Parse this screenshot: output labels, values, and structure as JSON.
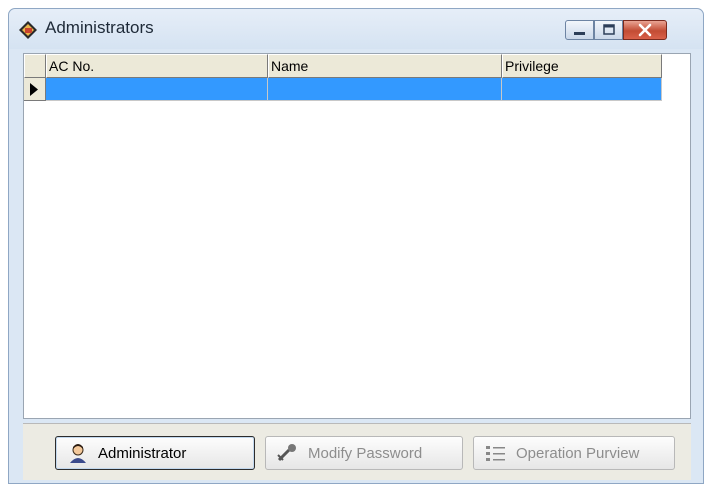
{
  "window": {
    "title": "Administrators"
  },
  "grid": {
    "columns": [
      "AC No.",
      "Name",
      "Privilege"
    ],
    "rows": [
      [
        "",
        "",
        ""
      ]
    ],
    "selected_row_color": "#3399ff"
  },
  "buttons": {
    "administrator": "Administrator",
    "modify_password": "Modify Password",
    "operation_purview": "Operation Purview"
  },
  "colors": {
    "title_bg": "#dbe7f4",
    "close_button": "#c34c34",
    "header_bg": "#ece9d8"
  }
}
